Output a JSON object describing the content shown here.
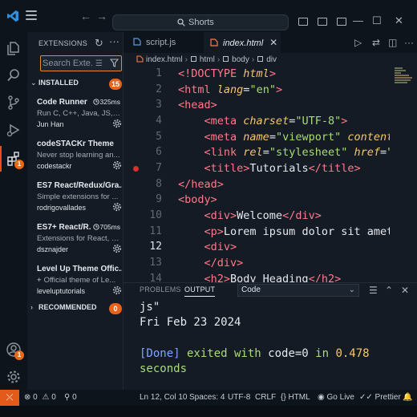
{
  "titlebar": {
    "search_text": "Shorts"
  },
  "sidebar": {
    "header": "EXTENSIONS",
    "search_placeholder": "Search Exte...",
    "installed": {
      "label": "INSTALLED",
      "count": "15"
    },
    "recommended": {
      "label": "RECOMMENDED",
      "count": "0"
    },
    "extensions": [
      {
        "name": "Code Runner",
        "desc": "Run C, C++, Java, JS, P...",
        "author": "Jun Han",
        "time": "325ms"
      },
      {
        "name": "codeSTACKr Theme",
        "desc": "Never stop learning an...",
        "author": "codestackr",
        "time": ""
      },
      {
        "name": "ES7 React/Redux/Gra...",
        "desc": "Simple extensions for ...",
        "author": "rodrigovallades",
        "time": ""
      },
      {
        "name": "ES7+ React/R...",
        "desc": "Extensions for React, R...",
        "author": "dsznajder",
        "time": "705ms"
      },
      {
        "name": "Level Up Theme Offic...",
        "desc": "Official theme of Le...",
        "author": "leveluptutorials",
        "time": ""
      }
    ]
  },
  "tabs": [
    {
      "label": "script.js"
    },
    {
      "label": "index.html"
    }
  ],
  "breadcrumb": [
    "index.html",
    "html",
    "body",
    "div"
  ],
  "editor": {
    "line_numbers": [
      "1",
      "2",
      "3",
      "4",
      "5",
      "6",
      "7",
      "8",
      "9",
      "10",
      "11",
      "12",
      "13",
      "14"
    ],
    "current_line": "12"
  },
  "panel": {
    "tabs": [
      "PROBLEMS",
      "OUTPUT"
    ],
    "output_channel": "Code",
    "output": {
      "line1": "js\"",
      "line2": "Fri Feb 23 2024",
      "done": "[Done]",
      "exited": " exited with ",
      "code": "code=0",
      "in": " in ",
      "time": "0.478",
      "seconds": "seconds"
    }
  },
  "statusbar": {
    "errors": "0",
    "warnings": "0",
    "ports": "0",
    "position": "Ln 12, Col 10",
    "spaces": "Spaces: 4",
    "encoding": "UTF-8",
    "eol": "CRLF",
    "language": "HTML",
    "golive": "Go Live",
    "prettier": "Prettier"
  },
  "colors": {
    "accent": "#e35a1b",
    "badge": "#e8621a",
    "tag": "#ff7a8a",
    "string": "#a9dc76",
    "attribute": "#f4c76b"
  }
}
